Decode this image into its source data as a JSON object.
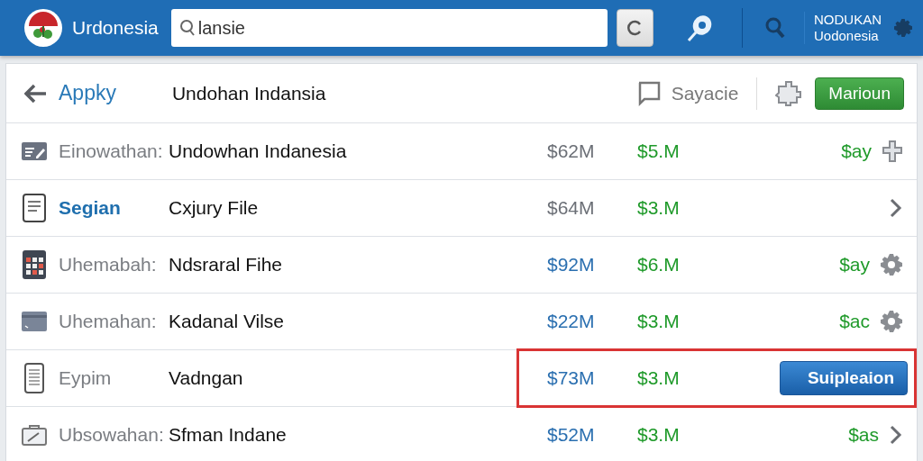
{
  "header": {
    "brand": "Urdonesia",
    "search": {
      "value": "lansie"
    },
    "account": {
      "line_1": "NODUKAN",
      "line_2": "Uodonesia"
    }
  },
  "toolbar": {
    "back_label": "Appky",
    "title": "Undohan Indansia",
    "comment_label": "Sayacie",
    "primary_button": "Marioun"
  },
  "rows": [
    {
      "label": "Einowathan:",
      "name": "Undowhan Indanesia",
      "amount": "$62M",
      "color": "#6b6f76",
      "value": "$5.M",
      "selected": false,
      "highlighted": false,
      "action": {
        "kind": "cross",
        "text": "$ay"
      }
    },
    {
      "label": "Segian",
      "name": "Cxjury File",
      "amount": "$64M",
      "color": "#6b6f76",
      "value": "$3.M",
      "selected": true,
      "highlighted": false,
      "action": {
        "kind": "chevron"
      }
    },
    {
      "label": "Uhemabah:",
      "name": "Ndsraral Fihe",
      "amount": "$92M",
      "color": "#2a6fb0",
      "value": "$6.M",
      "selected": false,
      "highlighted": false,
      "action": {
        "kind": "gear",
        "text": "$ay"
      }
    },
    {
      "label": "Uhemahan:",
      "name": "Kadanal Vilse",
      "amount": "$22M",
      "color": "#2a6fb0",
      "value": "$3.M",
      "selected": false,
      "highlighted": false,
      "action": {
        "kind": "gear",
        "text": "$ac"
      }
    },
    {
      "label": "Eypim",
      "name": "Vadngan",
      "amount": "$73M",
      "color": "#2a6fb0",
      "value": "$3.M",
      "selected": false,
      "highlighted": true,
      "action": {
        "kind": "button",
        "text": "Suipleaion"
      }
    },
    {
      "label": "Ubsowahan:",
      "name": "Sfman Indane",
      "amount": "$52M",
      "color": "#2a6fb0",
      "value": "$3.M",
      "selected": false,
      "highlighted": false,
      "action": {
        "kind": "chevron",
        "text": "$as"
      }
    }
  ]
}
